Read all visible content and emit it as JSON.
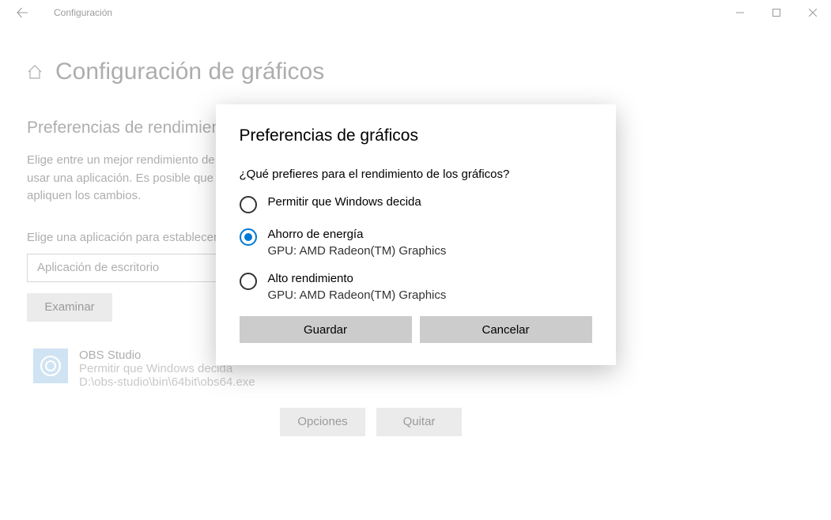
{
  "titlebar": {
    "back_sr": "Atrás",
    "title": "Configuración"
  },
  "header": {
    "page_title": "Configuración de gráficos"
  },
  "section": {
    "heading": "Preferencias de rendimiento de gráficos",
    "description": "Elige entre un mejor rendimiento de las aplicaciones o la duración de la batería al usar una aplicación. Es posible que tengas que reiniciar la aplicación para que se apliquen los cambios.",
    "dropdown_label": "Elige una aplicación para establecer las preferencias",
    "dropdown_value": "Aplicación de escritorio",
    "browse": "Examinar"
  },
  "app": {
    "name": "OBS Studio",
    "setting": "Permitir que Windows decida",
    "path": "D:\\obs-studio\\bin\\64bit\\obs64.exe"
  },
  "actions": {
    "options": "Opciones",
    "remove": "Quitar"
  },
  "dialog": {
    "title": "Preferencias de gráficos",
    "question": "¿Qué prefieres para el rendimiento de los gráficos?",
    "opt1": {
      "label": "Permitir que Windows decida"
    },
    "opt2": {
      "label": "Ahorro de energía",
      "sub": "GPU: AMD Radeon(TM) Graphics"
    },
    "opt3": {
      "label": "Alto rendimiento",
      "sub": "GPU: AMD Radeon(TM) Graphics"
    },
    "save": "Guardar",
    "cancel": "Cancelar"
  }
}
